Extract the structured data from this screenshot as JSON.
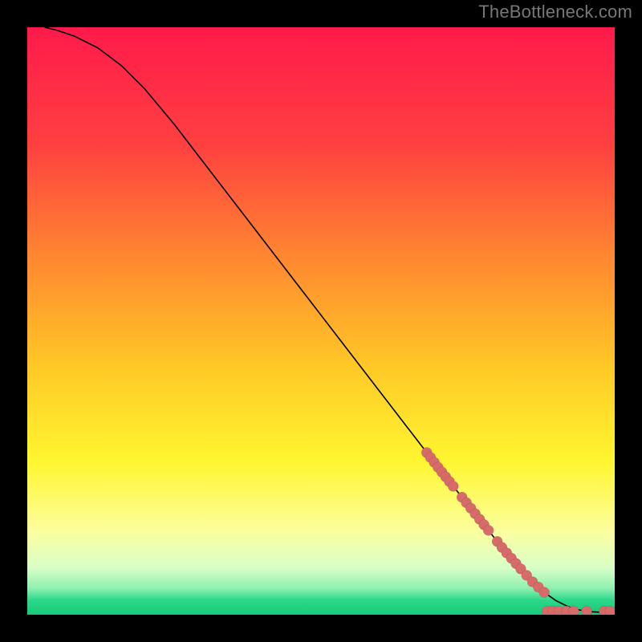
{
  "attribution": "TheBottleneck.com",
  "chart_data": {
    "type": "line",
    "title": "",
    "xlabel": "",
    "ylabel": "",
    "xlim": [
      0,
      100
    ],
    "ylim": [
      0,
      100
    ],
    "background_gradient": {
      "stops": [
        {
          "offset": 0.0,
          "color": "#ff1a4b"
        },
        {
          "offset": 0.2,
          "color": "#ff4040"
        },
        {
          "offset": 0.4,
          "color": "#ff8a30"
        },
        {
          "offset": 0.58,
          "color": "#ffc926"
        },
        {
          "offset": 0.74,
          "color": "#fff630"
        },
        {
          "offset": 0.86,
          "color": "#fbffa0"
        },
        {
          "offset": 0.92,
          "color": "#d8ffc8"
        },
        {
          "offset": 0.955,
          "color": "#8ff0b0"
        },
        {
          "offset": 0.975,
          "color": "#2bd88a"
        },
        {
          "offset": 1.0,
          "color": "#18c97a"
        }
      ]
    },
    "series": [
      {
        "name": "bottleneck-curve",
        "x": [
          3,
          5,
          8,
          12,
          16,
          20,
          25,
          30,
          35,
          40,
          45,
          50,
          55,
          60,
          65,
          70,
          74,
          78,
          81,
          84,
          86,
          88,
          90,
          92,
          94,
          96,
          98,
          100
        ],
        "y": [
          100,
          99.5,
          98.5,
          96.5,
          93.5,
          89.5,
          83.5,
          77,
          70.5,
          64,
          57.5,
          51,
          44.5,
          38,
          31.5,
          25,
          20,
          15,
          11.2,
          7.8,
          5.6,
          3.8,
          2.4,
          1.4,
          0.8,
          0.5,
          0.4,
          0.4
        ]
      }
    ],
    "dot_clusters": [
      {
        "name": "upper-segment",
        "x0": 68,
        "x1": 72.5,
        "y0": 27.5,
        "y1": 22,
        "count": 8
      },
      {
        "name": "mid-segment",
        "x0": 74,
        "x1": 78.5,
        "y0": 20,
        "y1": 14.5,
        "count": 7
      },
      {
        "name": "lower-segment",
        "x0": 80,
        "x1": 84,
        "y0": 12.5,
        "y1": 7.5,
        "count": 6
      },
      {
        "name": "curve-knee",
        "x0": 85,
        "x1": 88,
        "y0": 6.3,
        "y1": 3.5,
        "count": 4
      }
    ],
    "baseline_dots": {
      "name": "baseline-cluster",
      "y": 0.6,
      "xs": [
        88.5,
        89.5,
        90.5,
        91.8,
        93.0,
        95.2,
        98.2,
        99.2
      ]
    },
    "dot_radius_px": 6.5
  }
}
